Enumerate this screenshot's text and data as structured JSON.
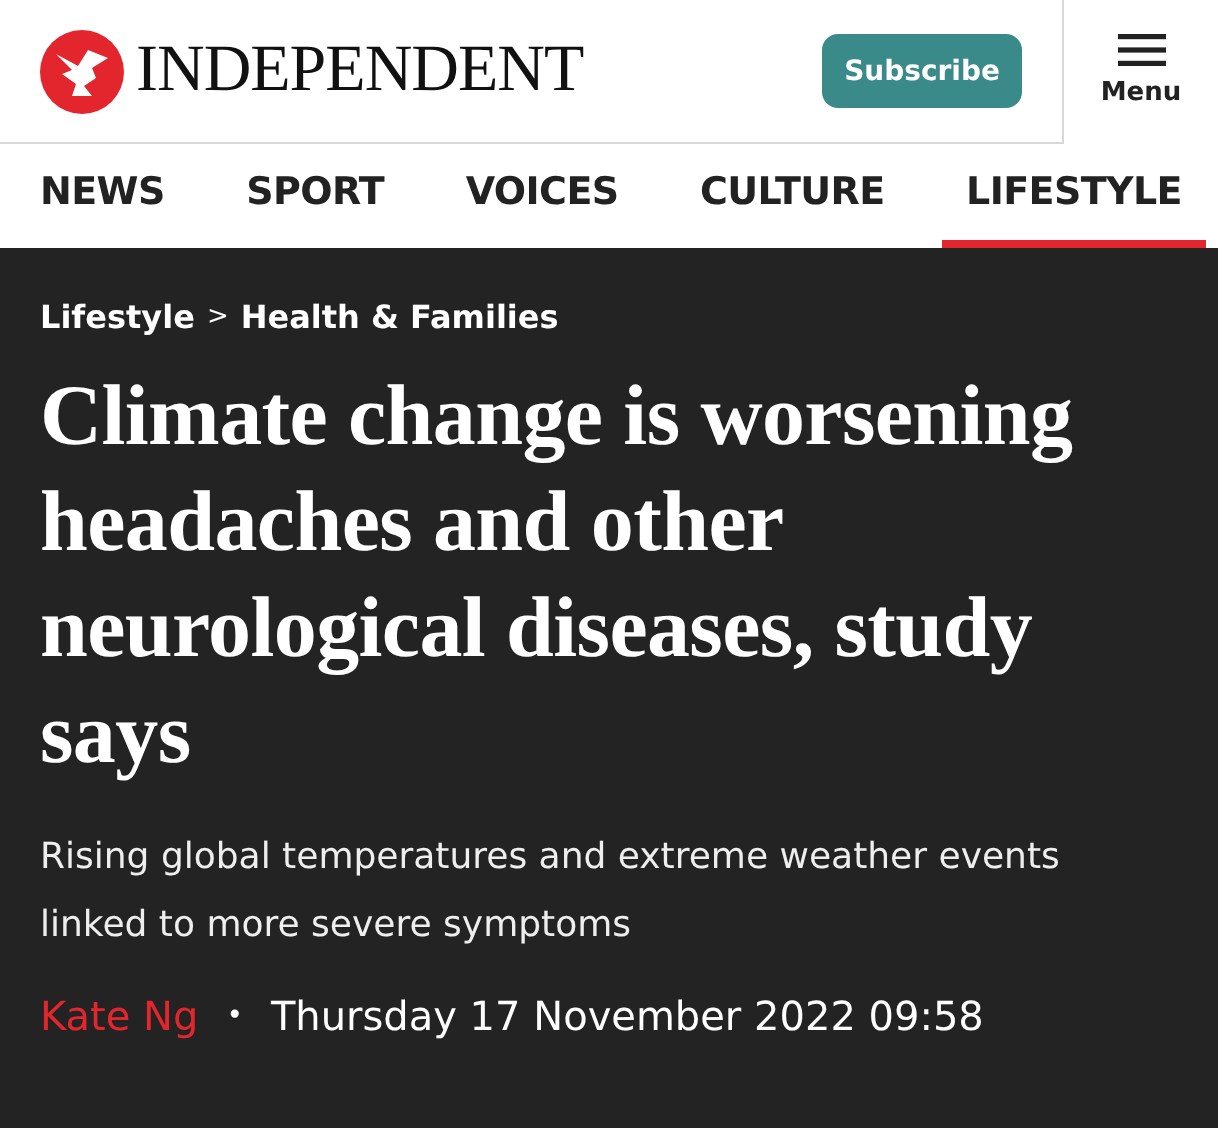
{
  "header": {
    "logo_text": "INDEPENDENT",
    "subscribe": "Subscribe",
    "menu": "Menu"
  },
  "nav": [
    {
      "label": "NEWS",
      "selected": false
    },
    {
      "label": "SPORT",
      "selected": false
    },
    {
      "label": "VOICES",
      "selected": false
    },
    {
      "label": "CULTURE",
      "selected": false
    },
    {
      "label": "LIFESTYLE",
      "selected": true
    }
  ],
  "article": {
    "breadcrumb": [
      {
        "label": "Lifestyle"
      },
      {
        "label": "Health & Families"
      }
    ],
    "breadcrumb_separator": ">",
    "headline": "Climate change is worsening headaches and other neurological diseases, study says",
    "standfirst": "Rising global temperatures and extreme weather events linked to more severe symptoms",
    "author": "Kate Ng",
    "separator": "•",
    "date": "Thursday 17 November 2022 09:58"
  }
}
